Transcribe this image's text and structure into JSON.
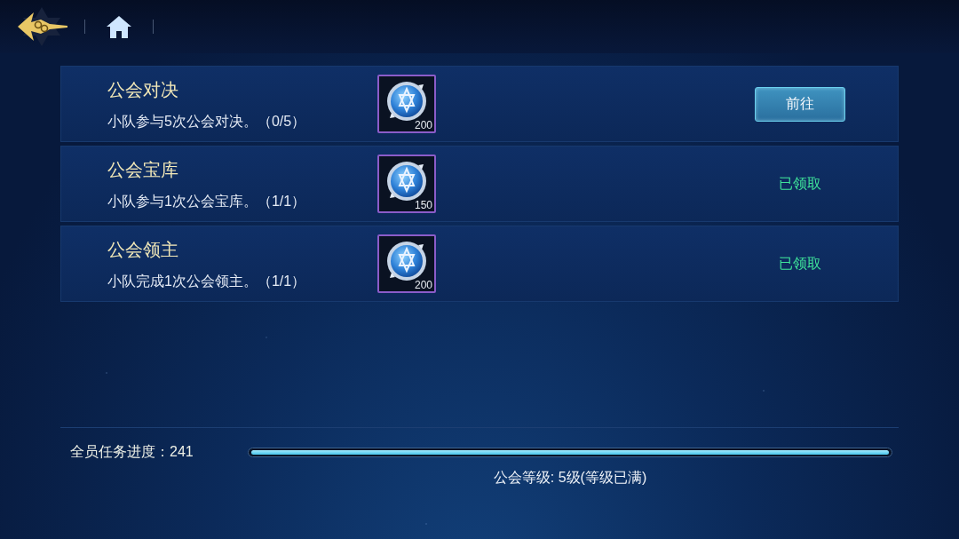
{
  "tasks": [
    {
      "title": "公会对决",
      "description": "小队参与5次公会对决。（0/5）",
      "reward": {
        "amount": "200"
      },
      "action": {
        "kind": "button",
        "label": "前往"
      }
    },
    {
      "title": "公会宝库",
      "description": "小队参与1次公会宝库。（1/1）",
      "reward": {
        "amount": "150"
      },
      "action": {
        "kind": "status",
        "label": "已领取"
      }
    },
    {
      "title": "公会领主",
      "description": "小队完成1次公会领主。（1/1）",
      "reward": {
        "amount": "200"
      },
      "action": {
        "kind": "status",
        "label": "已领取"
      }
    }
  ],
  "progress": {
    "label": "全员任务进度：241",
    "level": 1,
    "caption": "公会等级: 5级(等级已满)"
  }
}
